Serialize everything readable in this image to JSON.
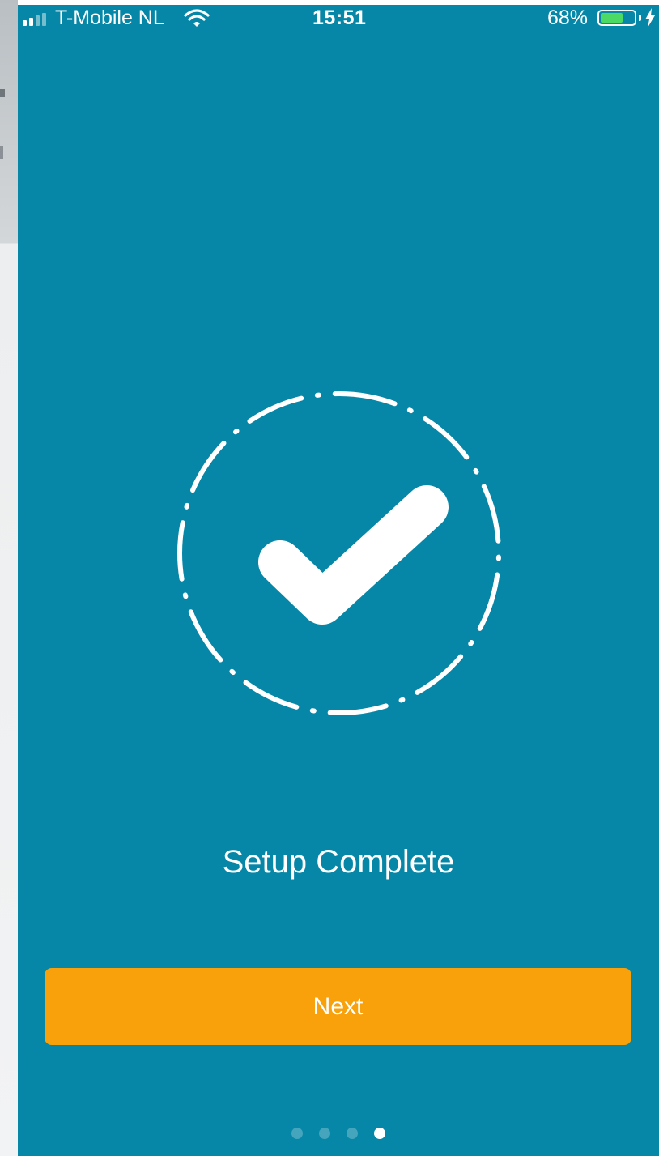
{
  "status_bar": {
    "carrier": "T-Mobile NL",
    "time": "15:51",
    "battery_percent": "68%",
    "battery_level": 0.68,
    "icons": [
      "signal-icon",
      "wifi-icon",
      "battery-icon",
      "charging-bolt-icon"
    ]
  },
  "main": {
    "graphic_icon": "checkmark-in-dashed-circle-icon",
    "title": "Setup Complete",
    "next_label": "Next"
  },
  "pagination": {
    "total": 4,
    "active_index": 3
  },
  "colors": {
    "background": "#0787a7",
    "button": "#f8a10b",
    "text": "#ffffff",
    "battery_fill": "#4cd964"
  }
}
